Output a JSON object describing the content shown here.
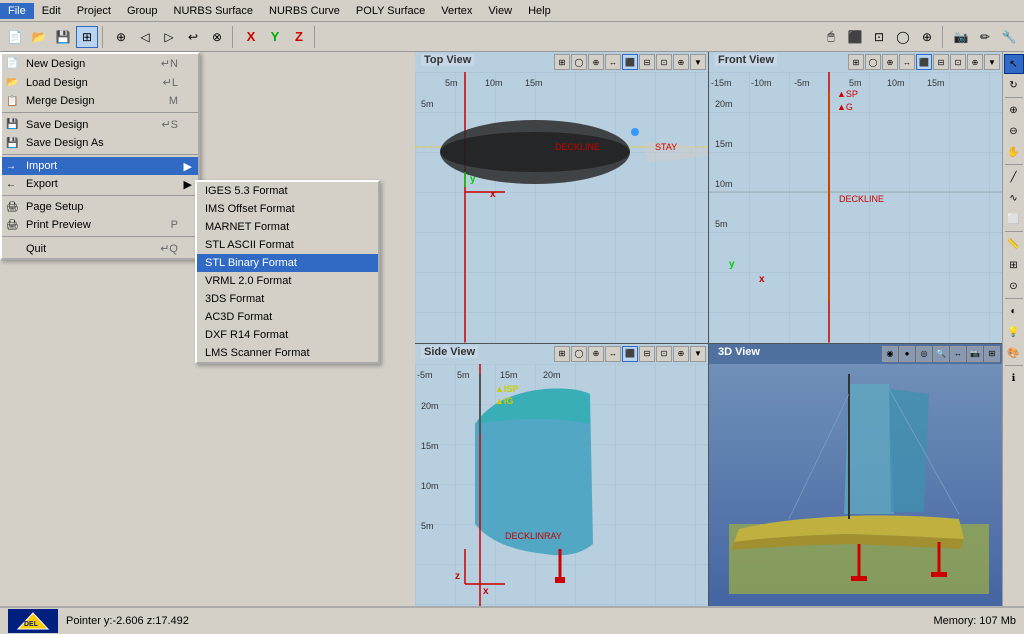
{
  "menubar": {
    "items": [
      "File",
      "Edit",
      "Project",
      "Group",
      "NURBS Surface",
      "NURBS Curve",
      "POLY Surface",
      "Vertex",
      "View",
      "Help"
    ]
  },
  "file_menu": {
    "items": [
      {
        "label": "New Design",
        "shortcut": "↵N",
        "icon": "📄"
      },
      {
        "label": "Load Design",
        "shortcut": "↵L",
        "icon": "📂"
      },
      {
        "label": "Merge Design",
        "shortcut": "M",
        "icon": "📋"
      },
      {
        "label": "Save Design",
        "shortcut": "↵S",
        "icon": "💾"
      },
      {
        "label": "Save Design As",
        "shortcut": "",
        "icon": "💾"
      },
      {
        "label": "Import",
        "arrow": "▶",
        "hovered": true
      },
      {
        "label": "Export",
        "arrow": "▶"
      },
      {
        "label": "Page Setup",
        "shortcut": ""
      },
      {
        "label": "Print Preview",
        "shortcut": "P"
      },
      {
        "label": "Quit",
        "shortcut": "↵Q"
      }
    ]
  },
  "import_submenu": {
    "items": [
      {
        "label": "IGES 5.3 Format"
      },
      {
        "label": "IMS Offset Format"
      },
      {
        "label": "MARNET Format"
      },
      {
        "label": "STL ASCII Format"
      },
      {
        "label": "STL Binary Format",
        "selected": true
      },
      {
        "label": "VRML 2.0 Format"
      },
      {
        "label": "3DS Format"
      },
      {
        "label": "AC3D Format"
      },
      {
        "label": "DXF R14 Format"
      },
      {
        "label": "LMS Scanner Format"
      }
    ]
  },
  "viewports": {
    "top": {
      "label": "Top View"
    },
    "front": {
      "label": "Front View"
    },
    "side": {
      "label": "Side View"
    },
    "threed": {
      "label": "3D View"
    }
  },
  "status": {
    "pointer": "Pointer y:-2.606 z:17.492",
    "memory": "Memory: 107 Mb"
  },
  "right_toolbar": {
    "buttons": [
      "↖",
      "✋",
      "↔",
      "↕",
      "⤡",
      "🔄",
      "◉",
      "⊕",
      "∿",
      "⌂",
      "▣",
      "◈",
      "≡",
      "⊞",
      "⋯",
      "◐",
      "⊗"
    ]
  }
}
